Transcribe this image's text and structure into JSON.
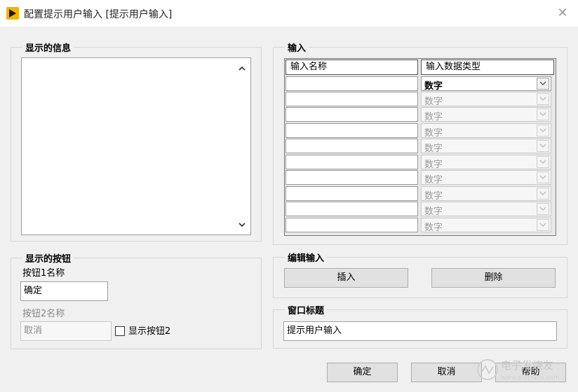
{
  "window": {
    "title": "配置提示用户输入 [提示用户输入]",
    "close_symbol": "✕"
  },
  "message_group": {
    "title": "显示的信息",
    "text": ""
  },
  "buttons_group": {
    "title": "显示的按钮",
    "button1_label": "按钮1名称",
    "button1_value": "确定",
    "button2_label": "按钮2名称",
    "button2_value": "取消",
    "show_button2_label": "显示按钮2",
    "show_button2_checked": false
  },
  "inputs_group": {
    "title": "输入",
    "columns": [
      "输入名称",
      "输入数据类型"
    ],
    "rows": [
      {
        "name": "",
        "type": "数字"
      },
      {
        "name": "",
        "type": "数字"
      },
      {
        "name": "",
        "type": "数字"
      },
      {
        "name": "",
        "type": "数字"
      },
      {
        "name": "",
        "type": "数字"
      },
      {
        "name": "",
        "type": "数字"
      },
      {
        "name": "",
        "type": "数字"
      },
      {
        "name": "",
        "type": "数字"
      },
      {
        "name": "",
        "type": "数字"
      },
      {
        "name": "",
        "type": "数字"
      }
    ]
  },
  "edit_group": {
    "title": "编辑输入",
    "insert_label": "插入",
    "delete_label": "删除"
  },
  "window_title_group": {
    "title": "窗口标题",
    "value": "提示用户输入"
  },
  "footer": {
    "ok_label": "确定",
    "cancel_label": "取消",
    "help_label": "帮助"
  },
  "watermark": {
    "text": "电子发烧友",
    "sub": "www.elecfans.com"
  },
  "colors": {
    "app_icon": "#f2b400"
  }
}
